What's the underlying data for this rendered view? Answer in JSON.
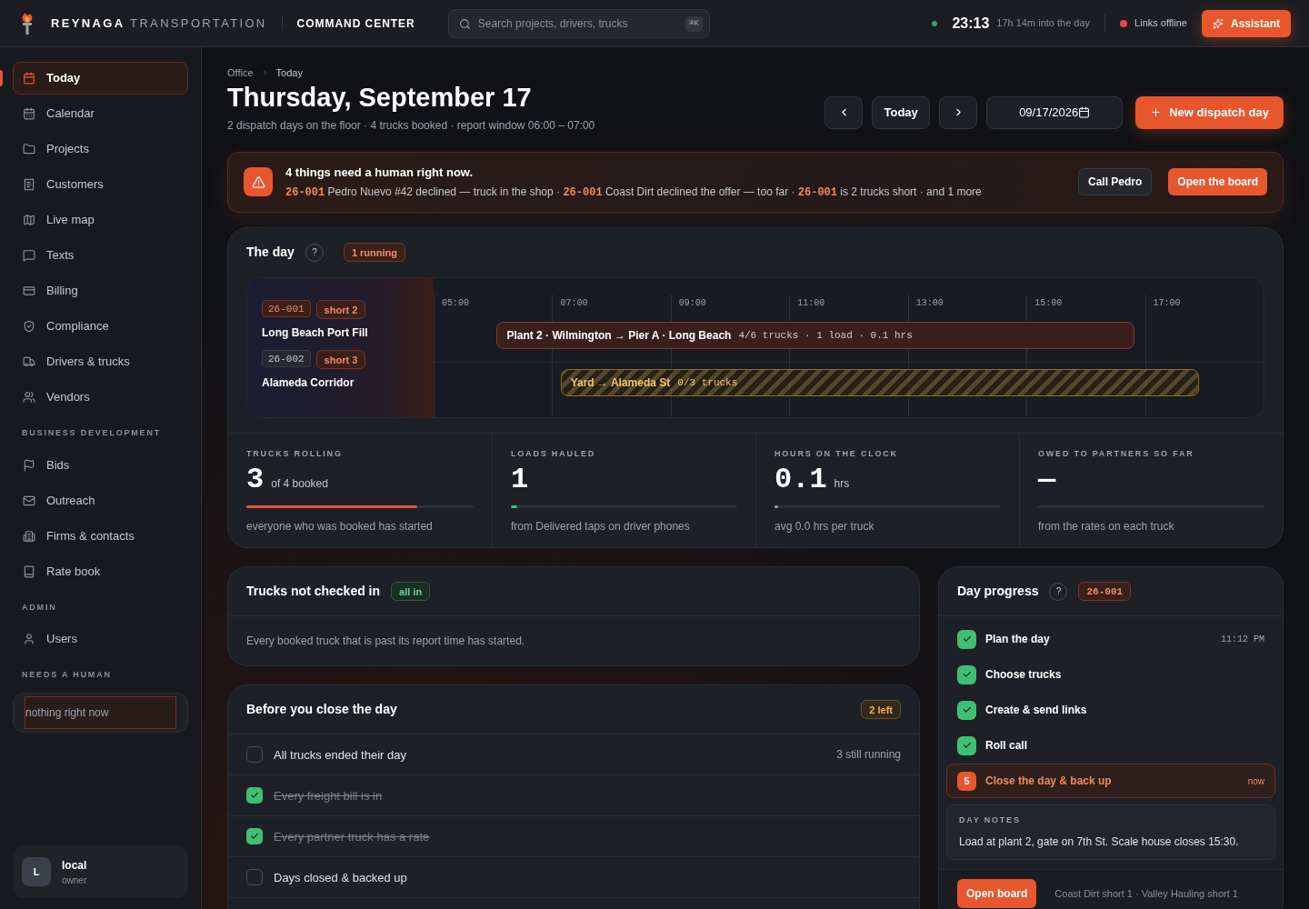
{
  "header": {
    "brand_bold": "REYNAGA",
    "brand_light": "TRANSPORTATION",
    "section": "COMMAND CENTER",
    "search": {
      "placeholder": "Search projects, drivers, trucks",
      "shortcut": "⌘K"
    },
    "clock": "23:13",
    "clock_note": "17h 14m into the day",
    "links_status": "Links offline",
    "links_online": false,
    "assistant": "Assistant"
  },
  "sidebar": {
    "groups": [
      {
        "items": [
          {
            "label": "Today",
            "selected": true
          },
          {
            "label": "Calendar",
            "selected": false
          },
          {
            "label": "Projects",
            "selected": false
          },
          {
            "label": "Customers",
            "selected": false
          },
          {
            "label": "Live map",
            "selected": false
          },
          {
            "label": "Texts",
            "selected": false
          },
          {
            "label": "Billing",
            "selected": false
          },
          {
            "label": "Compliance",
            "selected": false
          },
          {
            "label": "Drivers & trucks",
            "selected": false
          },
          {
            "label": "Vendors",
            "selected": false
          }
        ]
      },
      {
        "heading": "BUSINESS DEVELOPMENT",
        "items": [
          {
            "label": "Bids",
            "selected": false
          },
          {
            "label": "Outreach",
            "selected": false
          },
          {
            "label": "Firms & contacts",
            "selected": false
          },
          {
            "label": "Rate book",
            "selected": false
          }
        ]
      },
      {
        "heading": "ADMIN",
        "items": [
          {
            "label": "Users",
            "selected": false
          }
        ]
      }
    ],
    "needs_human": {
      "heading": "NEEDS A HUMAN",
      "text": "nothing right now"
    },
    "user": {
      "initial": "L",
      "name": "local",
      "role": "owner"
    }
  },
  "page": {
    "breadcrumb": [
      "Office",
      "Today"
    ],
    "title": "Thursday, September 17",
    "subtitle": "2 dispatch days on the floor · 4 trucks booked · report window 06:00 – 07:00",
    "today_button": "Today",
    "date": "09/17/2026",
    "new_button": "New dispatch day"
  },
  "alert": {
    "title": "4 things need a human right now.",
    "parts": [
      {
        "kind": "code",
        "text": "26-001"
      },
      {
        "kind": "text",
        "text": " Pedro Nuevo #42 declined — truck in the shop · "
      },
      {
        "kind": "code",
        "text": "26-001"
      },
      {
        "kind": "text",
        "text": " Coast Dirt declined the offer — too far · "
      },
      {
        "kind": "code",
        "text": "26-001"
      },
      {
        "kind": "text",
        "text": " is 2 trucks short · and 1 more"
      }
    ],
    "buttons": [
      {
        "label": "Call Pedro",
        "kind": "secondary"
      },
      {
        "label": "Open the board",
        "kind": "primary"
      }
    ]
  },
  "day": {
    "title": "The day",
    "help": "?",
    "badge": "1 running",
    "timeline": {
      "ticks": [
        "05:00",
        "07:00",
        "09:00",
        "11:00",
        "13:00",
        "15:00",
        "17:00"
      ],
      "projects": [
        {
          "code": "26-001",
          "active": true,
          "short": "short 2",
          "name": "Long Beach Port Fill"
        },
        {
          "code": "26-002",
          "active": false,
          "short": "short 3",
          "name": "Alameda Corridor"
        }
      ],
      "bars": [
        {
          "kind": "running",
          "route": "Plant 2 · Wilmington → Pier A · Long Beach",
          "meta": "4/6 trucks · 1 load · 0.1 hrs"
        },
        {
          "kind": "pending",
          "route": "Yard → Alameda St",
          "meta": "0/3 trucks"
        }
      ]
    },
    "stats": [
      {
        "label": "TRUCKS ROLLING",
        "value": "3",
        "unit": "of 4 booked",
        "level": 0.75,
        "color": "#e8562e",
        "caption": "everyone who was booked has started"
      },
      {
        "label": "LOADS HAULED",
        "value": "1",
        "level": 0.03,
        "color": "#3fbf73",
        "caption": "from Delivered taps on driver phones"
      },
      {
        "label": "HOURS ON THE CLOCK",
        "value": "0.1",
        "unit": "hrs",
        "level": 0.003,
        "color": "#9ca3af",
        "caption": "avg 0.0 hrs per truck"
      },
      {
        "label": "OWED TO PARTNERS SO FAR",
        "value": "—",
        "caption": "from the rates on each truck"
      }
    ]
  },
  "checkin": {
    "title": "Trucks not checked in",
    "badge": "all in",
    "text": "Every booked truck that is past its report time has started."
  },
  "closing": {
    "title": "Before you close the day",
    "badge": "2 left",
    "items": [
      {
        "label": "All trucks ended their day",
        "checked": false,
        "note": "3 still running"
      },
      {
        "label": "Every freight bill is in",
        "checked": true
      },
      {
        "label": "Every partner truck has a rate",
        "checked": true
      },
      {
        "label": "Days closed & backed up",
        "checked": false
      }
    ]
  },
  "progress": {
    "title": "Day progress",
    "help": "?",
    "badge": "26-001",
    "steps": [
      {
        "label": "Plan the day",
        "done": true,
        "time": "11:12 PM"
      },
      {
        "label": "Choose trucks",
        "done": true
      },
      {
        "label": "Create & send links",
        "done": true
      },
      {
        "label": "Roll call",
        "done": true
      },
      {
        "label": "Close the day & back up",
        "done": false,
        "number": "5",
        "time": "now"
      }
    ],
    "notes": {
      "heading": "DAY NOTES",
      "text": "Load at plant 2, gate on 7th St. Scale house closes 15:30."
    },
    "footer_button": "Open board",
    "footer_text": "Coast Dirt short 1 · Valley Hauling short 1"
  }
}
